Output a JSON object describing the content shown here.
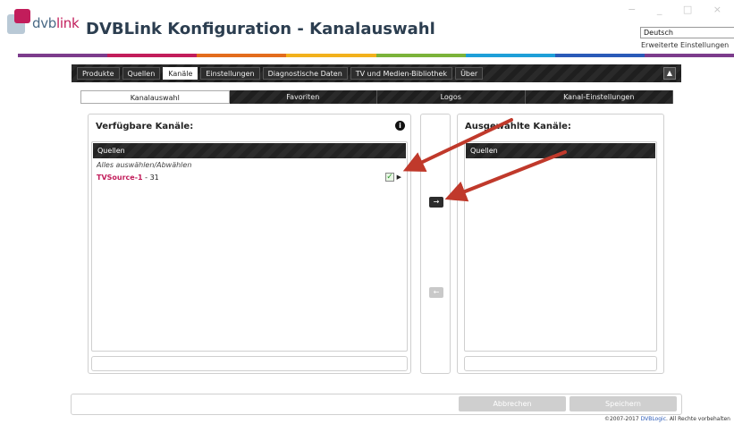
{
  "header": {
    "logo_text": "dvb",
    "logo_text_accent": "link",
    "title": "DVBLink Konfiguration - Kanalauswahl",
    "window_controls": "− _ □ ×",
    "language": "Deutsch",
    "advanced_settings": "Erweiterte Einstellungen"
  },
  "brand_colors": [
    "#7c3c8c",
    "#c21d5b",
    "#e36c1d",
    "#f2b11c",
    "#7bb33a",
    "#1e9fd8",
    "#2a5ab8",
    "#7c3c8c"
  ],
  "top_nav": {
    "tabs": [
      {
        "label": "Produkte"
      },
      {
        "label": "Quellen"
      },
      {
        "label": "Kanäle"
      },
      {
        "label": "Einstellungen"
      },
      {
        "label": "Diagnostische Daten"
      },
      {
        "label": "TV und Medien-Bibliothek"
      },
      {
        "label": "Über"
      }
    ],
    "active_tab": "Kanäle"
  },
  "sub_nav": {
    "tabs": [
      {
        "label": "Kanalauswahl"
      },
      {
        "label": "Favoriten"
      },
      {
        "label": "Logos"
      },
      {
        "label": "Kanal-Einstellungen"
      }
    ],
    "active_tab": "Kanalauswahl"
  },
  "left_panel": {
    "title": "Verfügbare Kanäle:",
    "info_icon": "i",
    "list_header": "Quellen",
    "select_all": "Alles auswählen/Abwählen",
    "source": {
      "name": "TVSource-1",
      "count": " - 31"
    },
    "checked": true
  },
  "middle": {
    "move_right": "→",
    "move_left": "←"
  },
  "right_panel": {
    "title": "Ausgewählte Kanäle:",
    "list_header": "Quellen"
  },
  "footer": {
    "cancel_label": "Abbrechen",
    "save_label": "Speichern",
    "copyright_prefix": "©2007-2017 ",
    "copyright_link": "DVBLogic",
    "copyright_suffix": ". All Rechte vorbehalten"
  }
}
